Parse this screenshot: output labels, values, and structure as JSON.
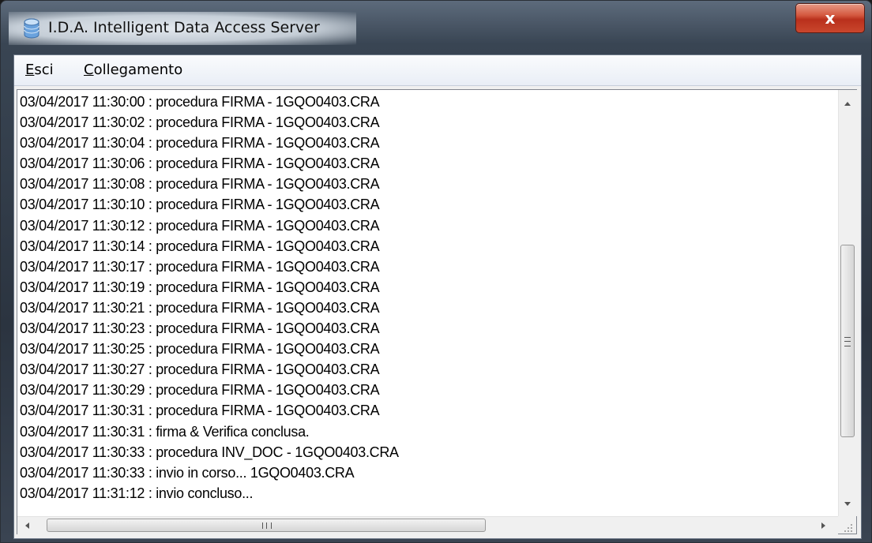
{
  "window": {
    "title": "I.D.A. Intelligent Data Access Server",
    "close_glyph": "x",
    "icon": "database-icon"
  },
  "menu": {
    "items": [
      {
        "label_accel": "E",
        "label_rest": "sci"
      },
      {
        "label_accel": "C",
        "label_rest": "ollegamento"
      }
    ]
  },
  "log": {
    "lines": [
      "03/04/2017 11:30:00 : procedura FIRMA - 1GQO0403.CRA",
      "03/04/2017 11:30:02 : procedura FIRMA - 1GQO0403.CRA",
      "03/04/2017 11:30:04 : procedura FIRMA - 1GQO0403.CRA",
      "03/04/2017 11:30:06 : procedura FIRMA - 1GQO0403.CRA",
      "03/04/2017 11:30:08 : procedura FIRMA - 1GQO0403.CRA",
      "03/04/2017 11:30:10 : procedura FIRMA - 1GQO0403.CRA",
      "03/04/2017 11:30:12 : procedura FIRMA - 1GQO0403.CRA",
      "03/04/2017 11:30:14 : procedura FIRMA - 1GQO0403.CRA",
      "03/04/2017 11:30:17 : procedura FIRMA - 1GQO0403.CRA",
      "03/04/2017 11:30:19 : procedura FIRMA - 1GQO0403.CRA",
      "03/04/2017 11:30:21 : procedura FIRMA - 1GQO0403.CRA",
      "03/04/2017 11:30:23 : procedura FIRMA - 1GQO0403.CRA",
      "03/04/2017 11:30:25 : procedura FIRMA - 1GQO0403.CRA",
      "03/04/2017 11:30:27 : procedura FIRMA - 1GQO0403.CRA",
      "03/04/2017 11:30:29 : procedura FIRMA - 1GQO0403.CRA",
      "03/04/2017 11:30:31 : procedura FIRMA - 1GQO0403.CRA",
      "03/04/2017 11:30:31 : firma & Verifica conclusa.",
      "03/04/2017 11:30:33 : procedura INV_DOC - 1GQO0403.CRA",
      "03/04/2017 11:30:33 : invio in corso... 1GQO0403.CRA",
      "03/04/2017 11:31:12 : invio concluso..."
    ]
  },
  "scrollbars": {
    "vertical": {
      "up_icon": "arrow-up-icon",
      "down_icon": "arrow-down-icon",
      "grip_icon": "grip-icon"
    },
    "horizontal": {
      "left_icon": "arrow-left-icon",
      "right_icon": "arrow-right-icon",
      "grip_icon": "grip-icon"
    }
  },
  "colors": {
    "close_button": "#c9462d",
    "menubar": "#e9eef6",
    "log_background": "#ffffff"
  }
}
